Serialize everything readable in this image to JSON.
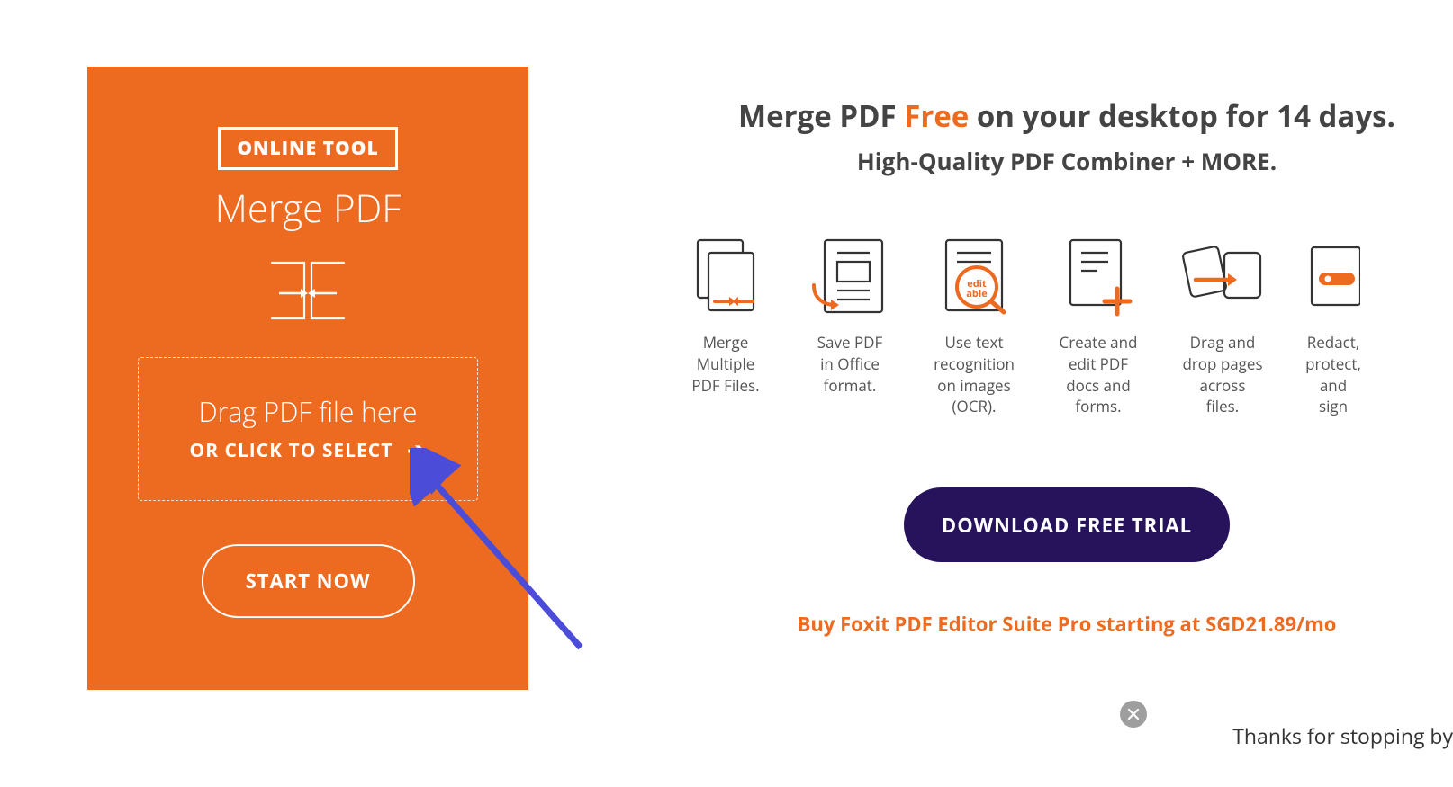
{
  "leftPanel": {
    "badge": "ONLINE TOOL",
    "title": "Merge PDF",
    "dropText1": "Drag PDF file here",
    "dropText2": "OR CLICK TO SELECT",
    "startNow": "START NOW"
  },
  "right": {
    "headlineA": "Merge PDF ",
    "headlineFree": "Free",
    "headlineB": " on your desktop for 14 days.",
    "sub": "High-Quality PDF Combiner + MORE.",
    "features": {
      "f1": "Merge Multiple PDF Files.",
      "f2": "Save PDF in Office format.",
      "f3": "Use text recognition on images (OCR).",
      "f4": "Create and edit PDF docs and forms.",
      "f5": "Drag and drop pages across files.",
      "f6": "Redact, protect, and sign"
    },
    "download": "DOWNLOAD FREE TRIAL",
    "buyLink": "Buy Foxit PDF Editor Suite Pro starting at SGD21.89/mo"
  },
  "chat": {
    "teaser": "Thanks for stopping by"
  }
}
